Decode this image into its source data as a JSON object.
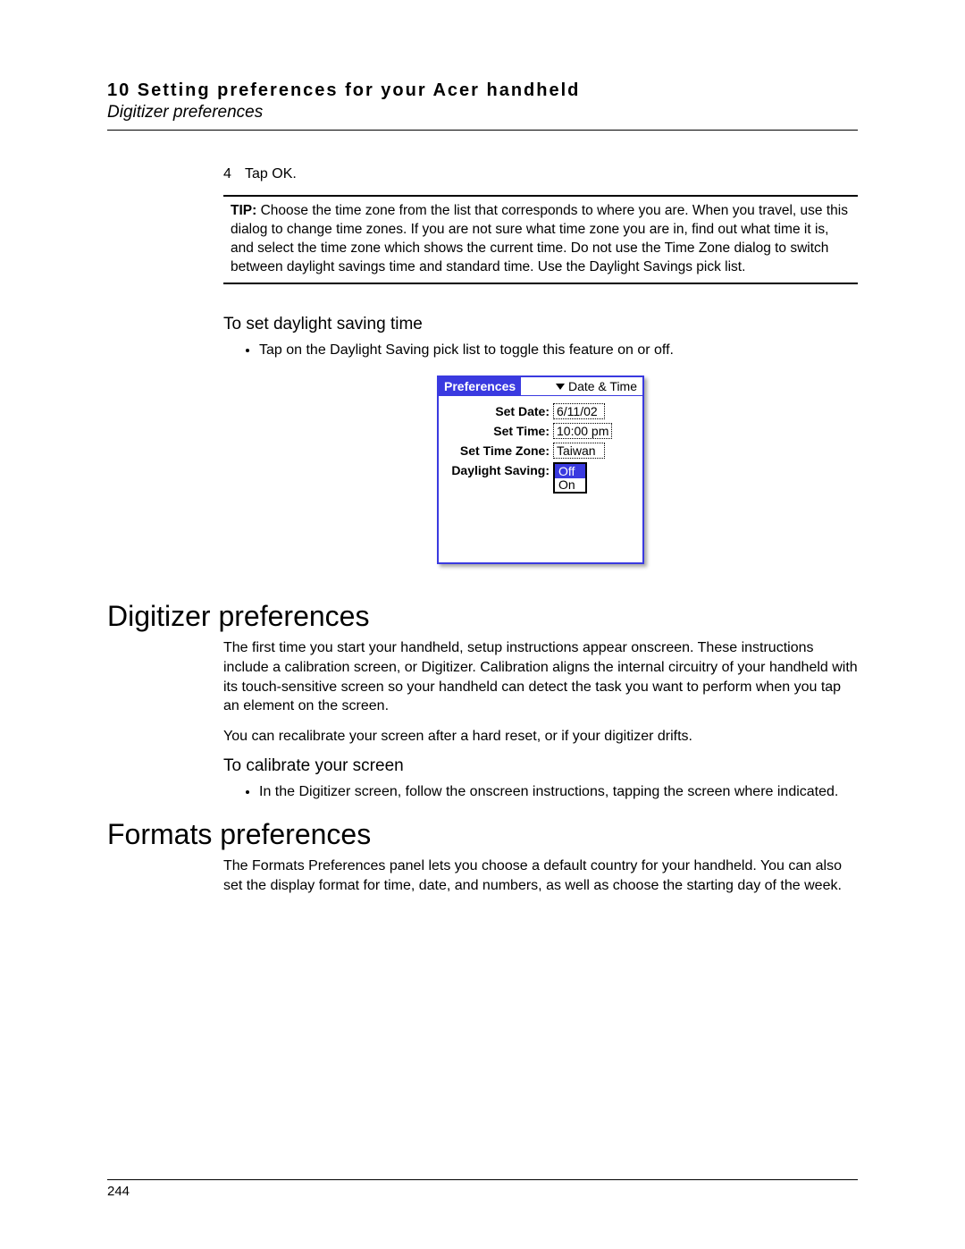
{
  "header": {
    "chapter": "10 Setting preferences for your Acer handheld",
    "section": "Digitizer preferences"
  },
  "step": {
    "num": "4",
    "text": "Tap OK."
  },
  "tip": {
    "label": "TIP:",
    "text": "Choose the time zone from the list that corresponds to where you are. When you travel, use this dialog to change time zones. If you are not sure what time zone you are in, find out what time it is, and select the time zone which shows the current time. Do not use the Time Zone dialog to switch between daylight savings time and standard time. Use the Daylight Savings pick list."
  },
  "daylight": {
    "heading": "To set daylight saving time",
    "bullet": "Tap on the Daylight Saving pick list to toggle this feature on or off."
  },
  "palm": {
    "title": "Preferences",
    "menu": "Date & Time",
    "rows": {
      "date_label": "Set Date:",
      "date_val": "6/11/02",
      "time_label": "Set Time:",
      "time_val": "10:00 pm",
      "tz_label": "Set Time Zone:",
      "tz_val": "Taiwan",
      "ds_label": "Daylight Saving:",
      "ds_sel": "Off",
      "ds_opt": "On"
    }
  },
  "digitizer": {
    "heading": "Digitizer preferences",
    "p1": "The first time you start your handheld, setup instructions appear onscreen. These instructions include a calibration screen, or Digitizer. Calibration aligns the internal circuitry of your handheld with its touch-sensitive screen so your handheld can detect the task you want to perform when you tap an element on the screen.",
    "p2": "You can recalibrate your screen after a hard reset, or if your digitizer drifts.",
    "sub": "To calibrate your screen",
    "bullet": "In the Digitizer screen, follow the onscreen instructions, tapping the screen where indicated."
  },
  "formats": {
    "heading": "Formats preferences",
    "p1": "The Formats Preferences panel lets you choose a default country for your handheld. You can also set the display format for time, date, and numbers, as well as choose the starting day of the week."
  },
  "page_number": "244"
}
